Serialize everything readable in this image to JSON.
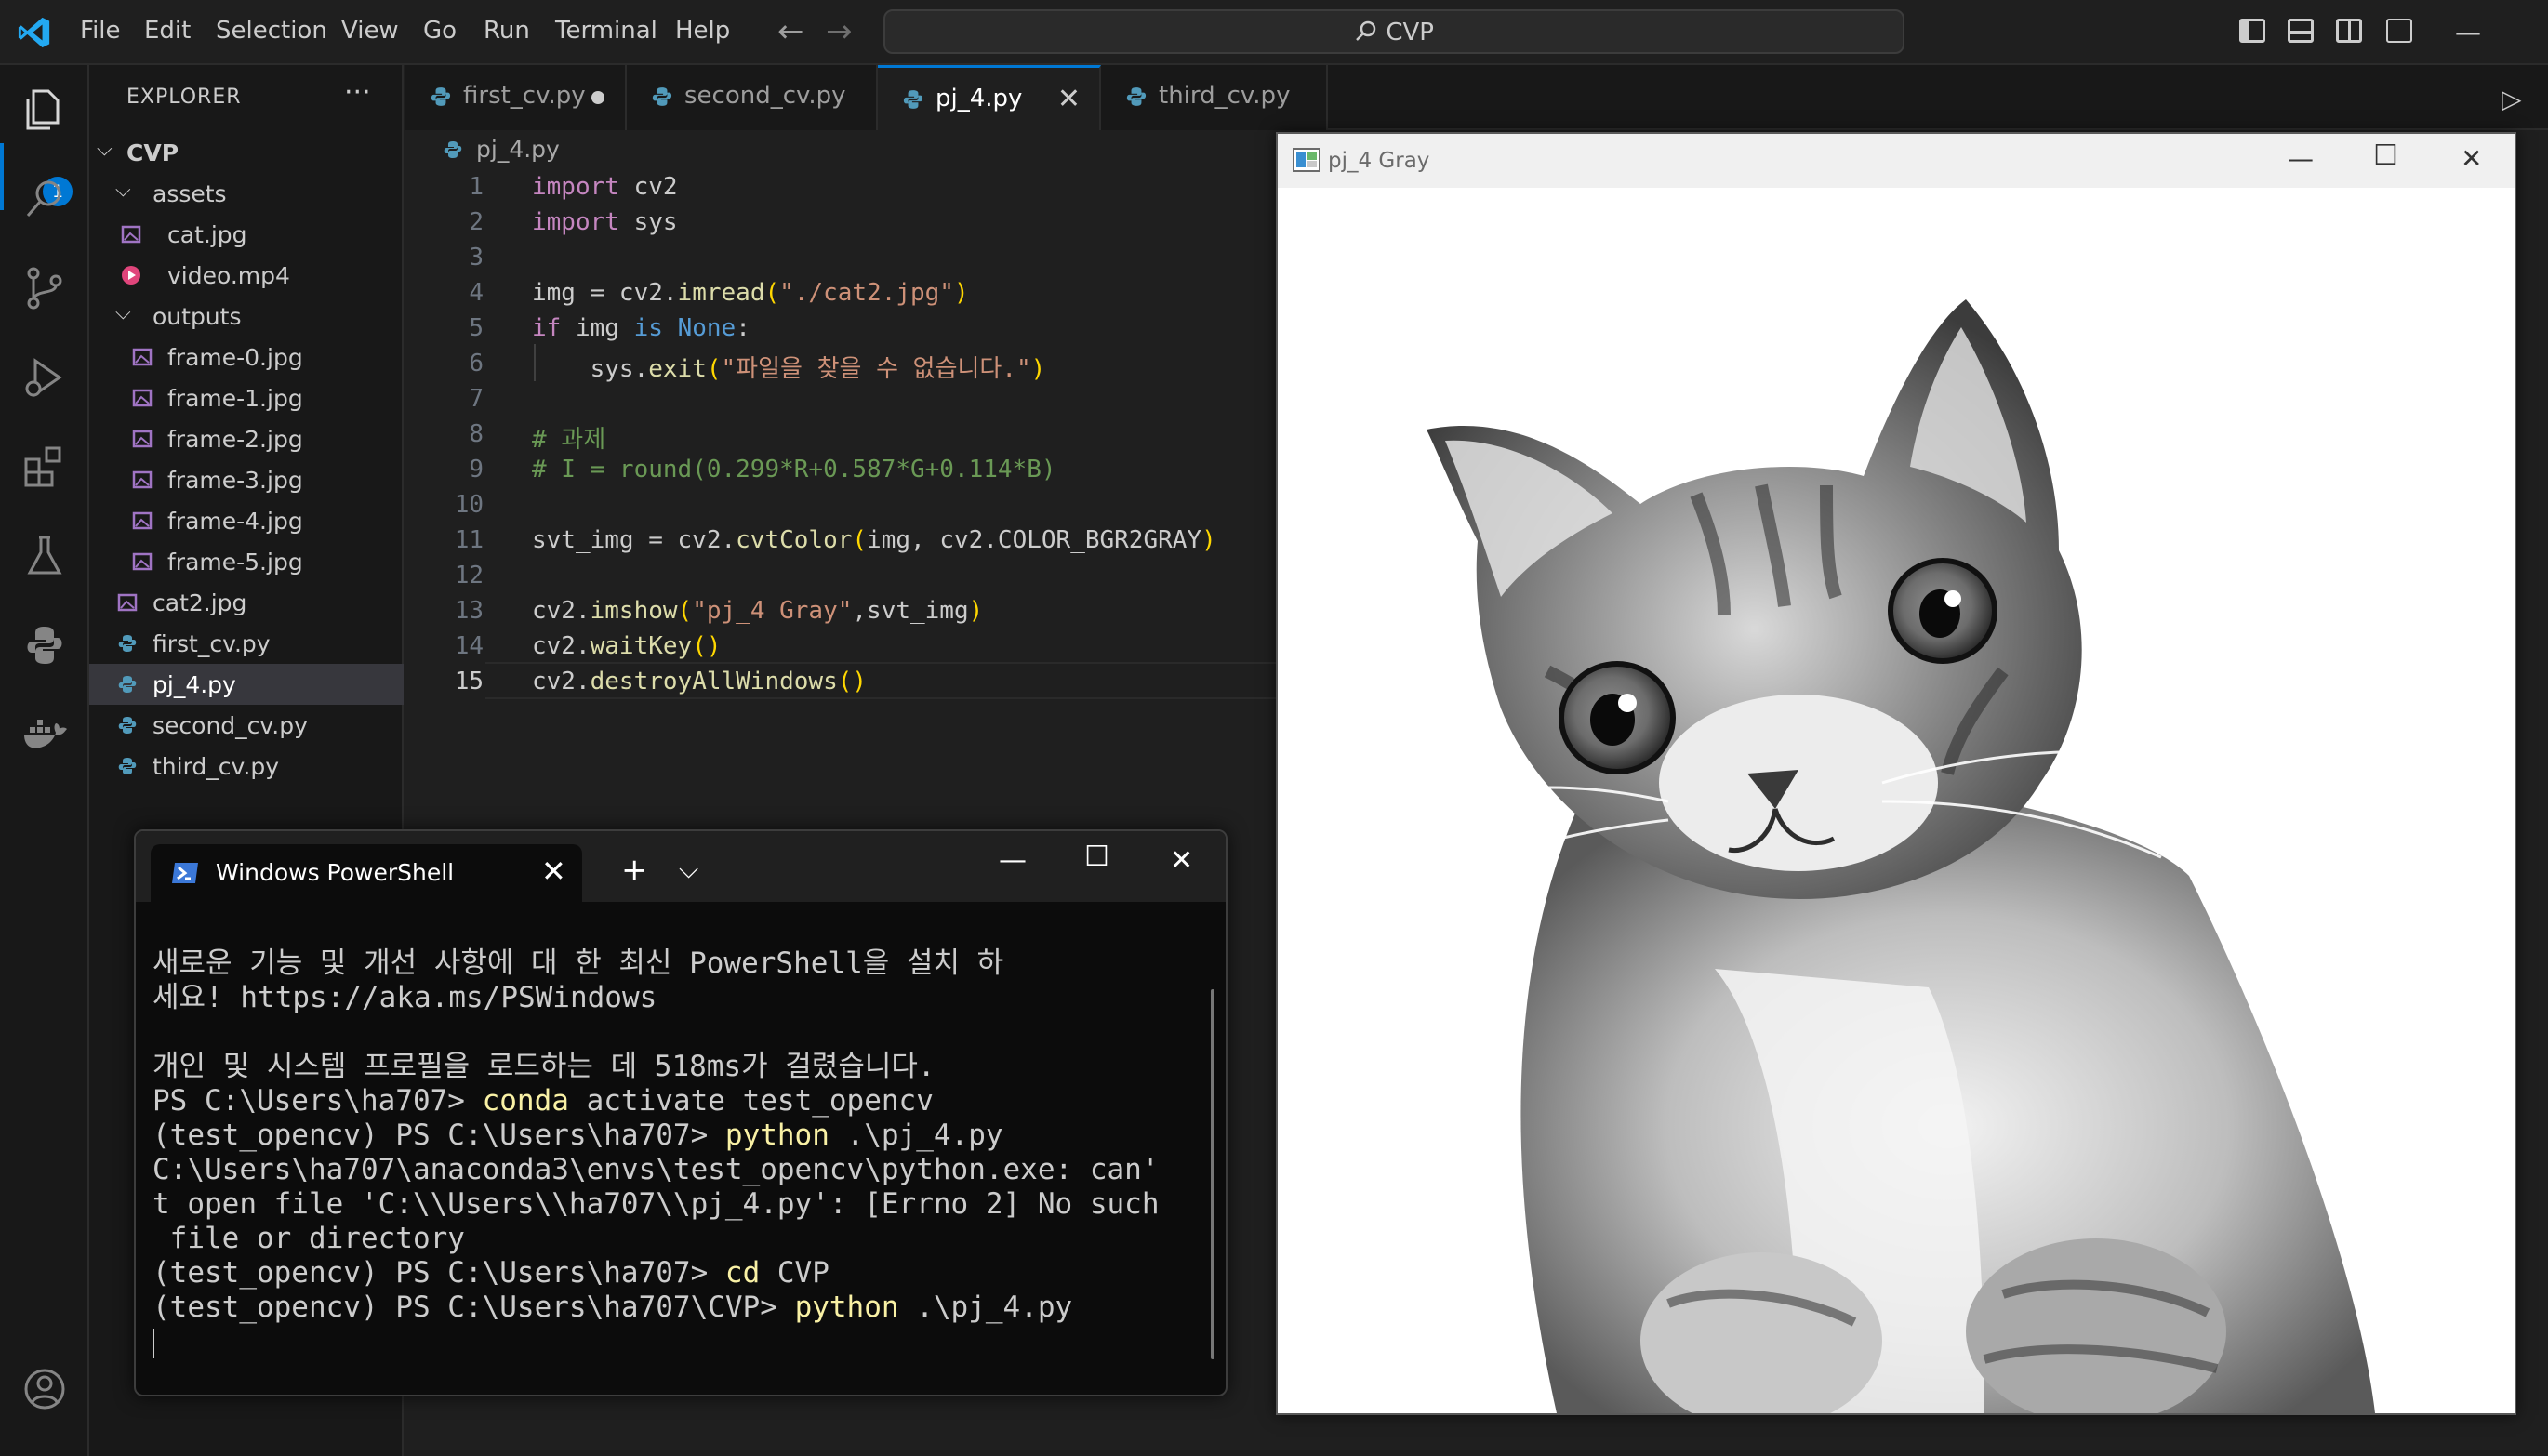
{
  "menu": [
    "File",
    "Edit",
    "Selection",
    "View",
    "Go",
    "Run",
    "Terminal",
    "Help"
  ],
  "search": {
    "text": "CVP"
  },
  "activity": {
    "explorer_badge": "1"
  },
  "explorer": {
    "title": "EXPLORER",
    "root": "CVP",
    "items": [
      {
        "label": "assets",
        "type": "folder"
      },
      {
        "label": "cat.jpg",
        "type": "image"
      },
      {
        "label": "video.mp4",
        "type": "video"
      },
      {
        "label": "outputs",
        "type": "folder"
      },
      {
        "label": "frame-0.jpg",
        "type": "image"
      },
      {
        "label": "frame-1.jpg",
        "type": "image"
      },
      {
        "label": "frame-2.jpg",
        "type": "image"
      },
      {
        "label": "frame-3.jpg",
        "type": "image"
      },
      {
        "label": "frame-4.jpg",
        "type": "image"
      },
      {
        "label": "frame-5.jpg",
        "type": "image"
      },
      {
        "label": "cat2.jpg",
        "type": "image"
      },
      {
        "label": "first_cv.py",
        "type": "python"
      },
      {
        "label": "pj_4.py",
        "type": "python",
        "selected": true
      },
      {
        "label": "second_cv.py",
        "type": "python"
      },
      {
        "label": "third_cv.py",
        "type": "python"
      }
    ]
  },
  "tabs": [
    {
      "label": "first_cv.py",
      "state": "modified"
    },
    {
      "label": "second_cv.py",
      "state": "normal"
    },
    {
      "label": "pj_4.py",
      "state": "active"
    },
    {
      "label": "third_cv.py",
      "state": "normal"
    }
  ],
  "breadcrumb": "pj_4.py",
  "code": {
    "line_numbers": [
      "1",
      "2",
      "3",
      "4",
      "5",
      "6",
      "7",
      "8",
      "9",
      "10",
      "11",
      "12",
      "13",
      "14",
      "15"
    ],
    "current_line": "15",
    "lines": [
      "import cv2",
      "import sys",
      "",
      "img = cv2.imread(\"./cat2.jpg\")",
      "if img is None:",
      "    sys.exit(\"파일을 찾을 수 없습니다.\")",
      "",
      "# 과제",
      "# I = round(0.299*R+0.587*G+0.114*B)",
      "",
      "svt_img = cv2.cvtColor(img, cv2.COLOR_BGR2GRAY)",
      "",
      "cv2.imshow(\"pj_4 Gray\",svt_img)",
      "cv2.waitKey()",
      "cv2.destroyAllWindows()"
    ]
  },
  "image_window": {
    "title": "pj_4 Gray"
  },
  "powershell": {
    "tab_title": "Windows PowerShell",
    "lines": [
      {
        "text": "새로운 기능 및 개선 사항에 대 한 최신 PowerShell을 설치 하"
      },
      {
        "text": "세요! https://aka.ms/PSWindows"
      },
      {
        "text": ""
      },
      {
        "text": "개인 및 시스템 프로필을 로드하는 데 518ms가 걸렸습니다."
      },
      {
        "prompt": "PS C:\\Users\\ha707> ",
        "cmd": "conda",
        "rest": " activate test_opencv"
      },
      {
        "prompt": "(test_opencv) PS C:\\Users\\ha707> ",
        "cmd": "python",
        "rest": " .\\pj_4.py"
      },
      {
        "text": "C:\\Users\\ha707\\anaconda3\\envs\\test_opencv\\python.exe: can'"
      },
      {
        "text": "t open file 'C:\\\\Users\\\\ha707\\\\pj_4.py': [Errno 2] No such"
      },
      {
        "text": " file or directory"
      },
      {
        "prompt": "(test_opencv) PS C:\\Users\\ha707> ",
        "cmd": "cd",
        "rest": " CVP"
      },
      {
        "prompt": "(test_opencv) PS C:\\Users\\ha707\\CVP> ",
        "cmd": "python",
        "rest": " .\\pj_4.py"
      }
    ]
  },
  "colors": {
    "accent": "#0078d4",
    "editor_bg": "#1f1f1f",
    "sidebar_bg": "#181818",
    "terminal_bg": "#0c0c0c"
  }
}
